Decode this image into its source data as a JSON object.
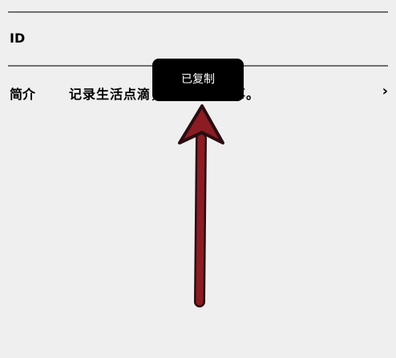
{
  "profile": {
    "id_label": "ID",
    "intro_label": "简介",
    "intro_value": "记录生活点滴，分享美好故事。"
  },
  "toast": {
    "text": "已复制"
  },
  "colors": {
    "background": "#efefef",
    "divider": "#6f6f6f",
    "toast_bg": "#000000",
    "annotation_arrow": "#8b1c24"
  },
  "icons": {
    "row_chevron": "chevron-right-icon",
    "annotation": "arrow-up-icon"
  }
}
